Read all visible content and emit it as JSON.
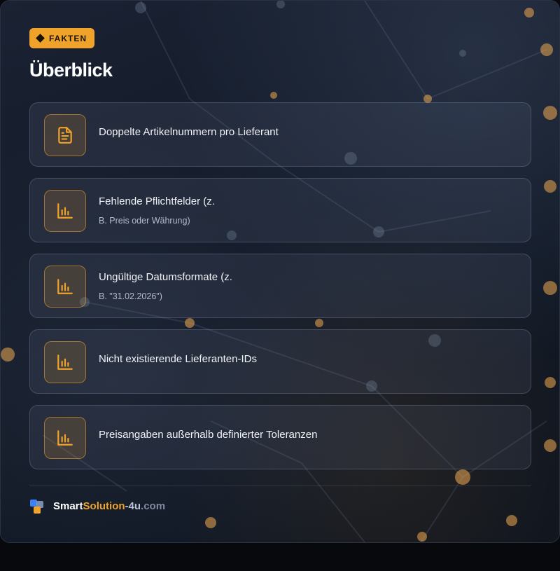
{
  "badge": {
    "label": "FAKTEN",
    "icon": "diamond-icon"
  },
  "title": "Überblick",
  "items": [
    {
      "icon": "document-icon",
      "main": "Doppelte Artikelnummern pro Lieferant",
      "sub": ""
    },
    {
      "icon": "bar-chart-icon",
      "main": "Fehlende Pflichtfelder (z.",
      "sub": "B. Preis oder Währung)"
    },
    {
      "icon": "bar-chart-icon",
      "main": "Ungültige Datumsformate (z.",
      "sub": "B. \"31.02.2026\")"
    },
    {
      "icon": "bar-chart-icon",
      "main": "Nicht existierende Lieferanten-IDs",
      "sub": ""
    },
    {
      "icon": "bar-chart-icon",
      "main": "Preisangaben außerhalb definierter Toleranzen",
      "sub": ""
    }
  ],
  "footer": {
    "brand_part1": "Smart",
    "brand_part2": "Solution",
    "brand_part3": "-4u",
    "brand_part4": ".com"
  },
  "colors": {
    "accent": "#f0a32a",
    "background": "#121a28",
    "text": "#f1f3f6",
    "subtext": "#b4bccb"
  }
}
